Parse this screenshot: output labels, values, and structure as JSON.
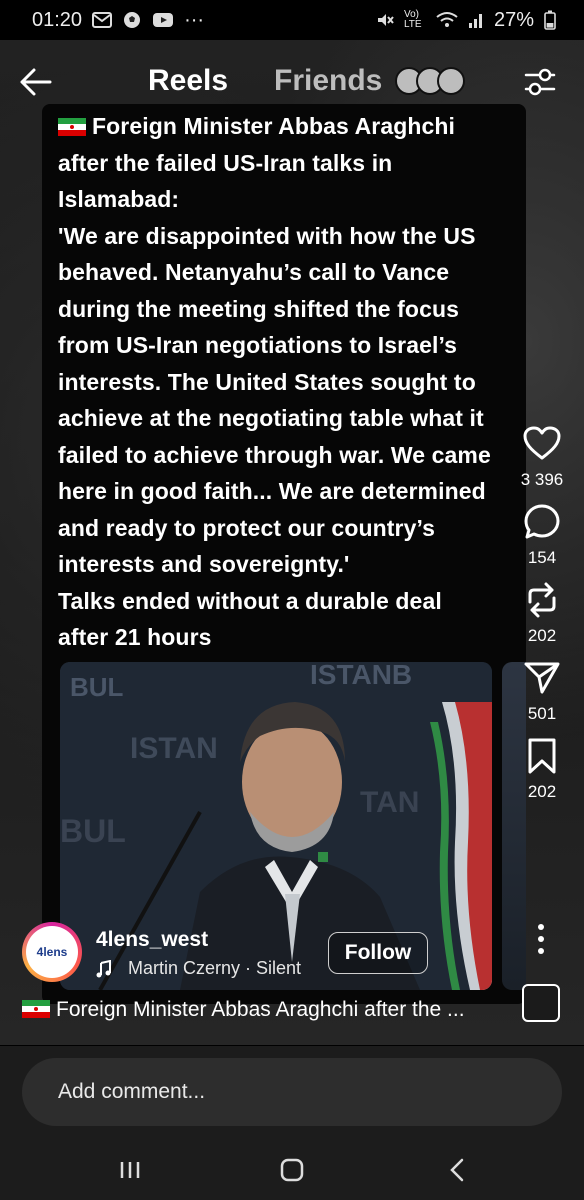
{
  "status_bar": {
    "time": "01:20",
    "dots": "···",
    "network_label": "Vo) LTE",
    "battery": "27%"
  },
  "top_bar": {
    "tabs": [
      {
        "label": "Reels",
        "active": true
      },
      {
        "label": "Friends",
        "active": false
      }
    ]
  },
  "post": {
    "text": "Foreign Minister Abbas Araghchi\nafter the failed US-Iran talks in\nIslamabad:\n'We are disappointed with how the US\nbehaved. Netanyahu’s call to Vance\nduring the meeting shifted the focus\nfrom US-Iran negotiations to Israel’s\ninterests. The United States sought to\nachieve at the negotiating table what it\nfailed to achieve through war. We came\nhere in good faith... We are determined\nand ready to protect our country’s\ninterests and sovereignty.'\nTalks ended without a durable deal\nafter 21 hours"
  },
  "actions": {
    "likes": "3 396",
    "comments": "154",
    "reposts": "202",
    "shares": "501",
    "saves": "202"
  },
  "author": {
    "avatar_text": "4lens",
    "username": "4lens_west",
    "music": "Martin Czerny · Silent",
    "follow_label": "Follow"
  },
  "caption": "Foreign Minister Abbas Araghchi after the ...",
  "comment": {
    "placeholder": "Add comment..."
  },
  "colors": {
    "background": "#000000",
    "bottom_panel": "#1c1c1c",
    "comment_box": "#2d2d2d",
    "friends_tab": "#bdbdbd"
  },
  "icons": [
    "back-arrow-icon",
    "filter-icon",
    "heart-icon",
    "comment-icon",
    "repost-icon",
    "send-icon",
    "bookmark-icon",
    "more-vertical-icon",
    "music-note-icon",
    "recent-apps-icon",
    "home-icon",
    "back-nav-icon"
  ]
}
